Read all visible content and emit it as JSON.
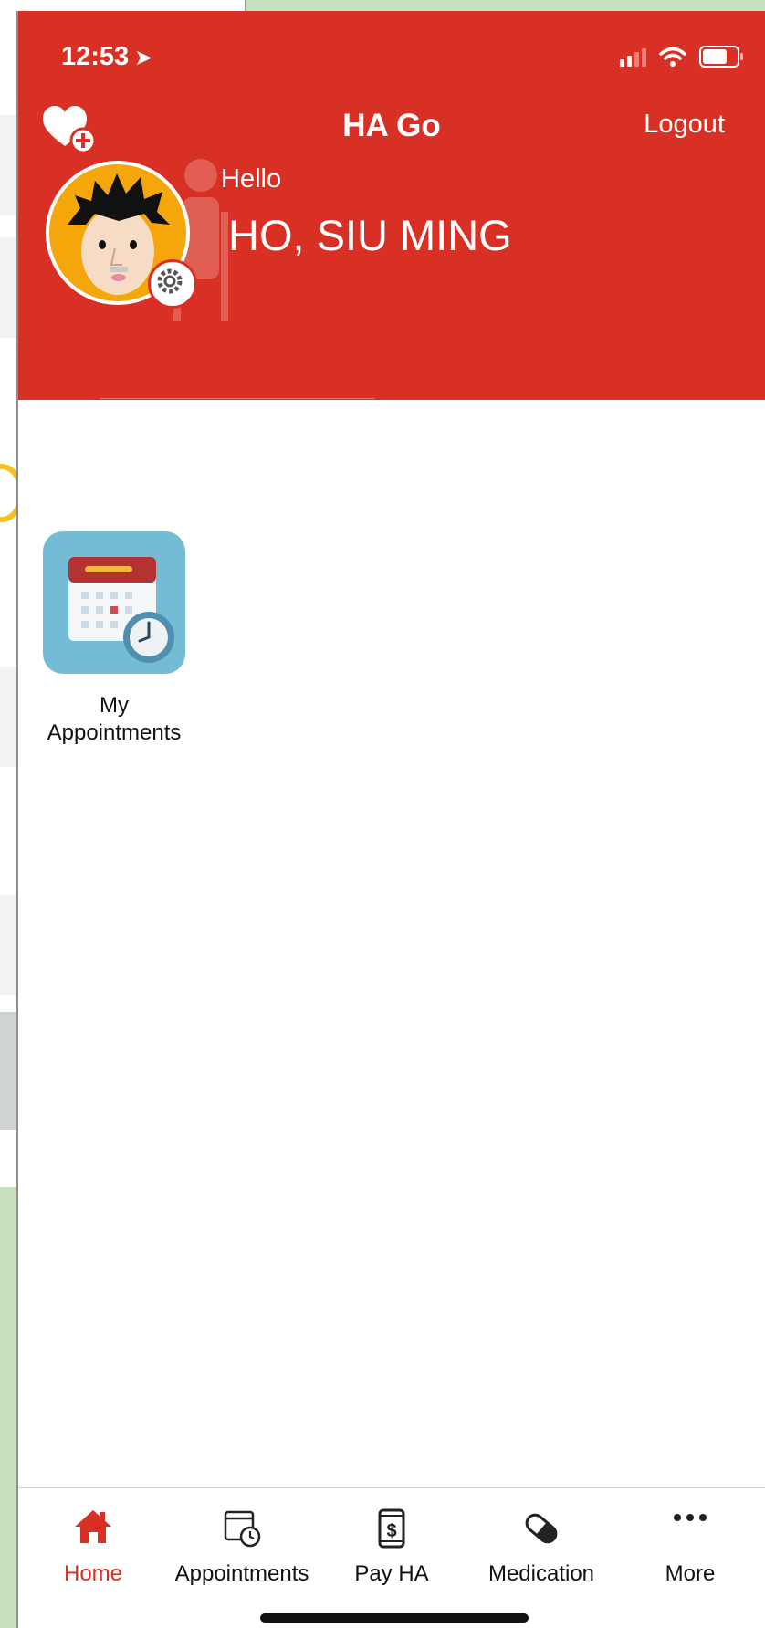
{
  "status_bar": {
    "time": "12:53",
    "location_icon": "location-arrow-icon"
  },
  "header": {
    "title": "HA Go",
    "logout_label": "Logout",
    "greeting": "Hello",
    "user_name": "HO, SIU MING",
    "favorite_icon": "heart-plus-icon"
  },
  "tiles": [
    {
      "label": "My Appointments",
      "icon": "calendar-clock-icon"
    }
  ],
  "tabbar": {
    "items": [
      {
        "label": "Home",
        "icon": "home-icon",
        "active": true
      },
      {
        "label": "Appointments",
        "icon": "calendar-clock-icon",
        "active": false
      },
      {
        "label": "Pay HA",
        "icon": "phone-dollar-icon",
        "active": false
      },
      {
        "label": "Medication",
        "icon": "pill-icon",
        "active": false
      },
      {
        "label": "More",
        "icon": "more-dots-icon",
        "active": false
      }
    ]
  },
  "colors": {
    "brand": "#d93025",
    "tile_bg": "#74bcd6",
    "avatar_bg": "#f5a60a"
  }
}
